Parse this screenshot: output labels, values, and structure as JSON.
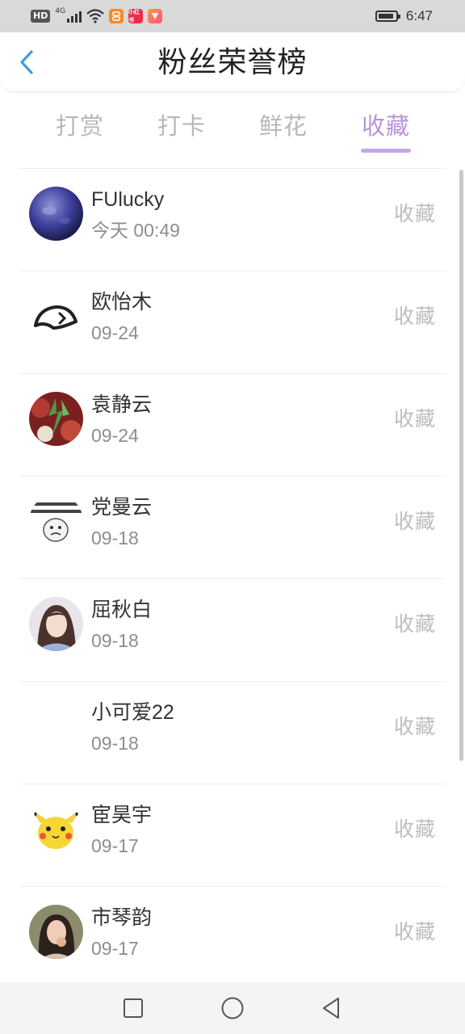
{
  "status_bar": {
    "hd_label": "HD",
    "network": "4G",
    "app_badges": [
      {
        "name": "taobao-app-icon",
        "text": "",
        "color": "#f58a2a"
      },
      {
        "name": "xiaohongshu-app-icon",
        "text": "小红书",
        "color": "#ef2b4b"
      },
      {
        "name": "red-gift-app-icon",
        "text": "",
        "color": "#ff5a7a"
      }
    ],
    "battery_level": 0.8,
    "time": "6:47"
  },
  "header": {
    "title": "粉丝荣誉榜",
    "back_icon": "chevron-left-icon",
    "accent_color": "#3aa0dc"
  },
  "tabs": {
    "items": [
      {
        "label": "打赏",
        "active": false
      },
      {
        "label": "打卡",
        "active": false
      },
      {
        "label": "鲜花",
        "active": false
      },
      {
        "label": "收藏",
        "active": true
      }
    ],
    "active_color": "#b794d7"
  },
  "list": {
    "items": [
      {
        "name": "FUlucky",
        "date": "今天 00:49",
        "action": "收藏",
        "avatar": "planet-avatar"
      },
      {
        "name": "欧怡木",
        "date": "09-24",
        "action": "收藏",
        "avatar": "sketch-icon-avatar"
      },
      {
        "name": "袁静云",
        "date": "09-24",
        "action": "收藏",
        "avatar": "vegetables-avatar"
      },
      {
        "name": "党曼云",
        "date": "09-18",
        "action": "收藏",
        "avatar": "meme-face-avatar"
      },
      {
        "name": "屈秋白",
        "date": "09-18",
        "action": "收藏",
        "avatar": "girl-photo-avatar"
      },
      {
        "name": "小可爱22",
        "date": "09-18",
        "action": "收藏",
        "avatar": "blank-avatar"
      },
      {
        "name": "宦昊宇",
        "date": "09-17",
        "action": "收藏",
        "avatar": "pikachu-avatar"
      },
      {
        "name": "市琴韵",
        "date": "09-17",
        "action": "收藏",
        "avatar": "girl-photo-avatar-2"
      }
    ]
  },
  "nav_bar": {
    "buttons": [
      "recents-square-icon",
      "home-circle-icon",
      "back-triangle-icon"
    ]
  }
}
